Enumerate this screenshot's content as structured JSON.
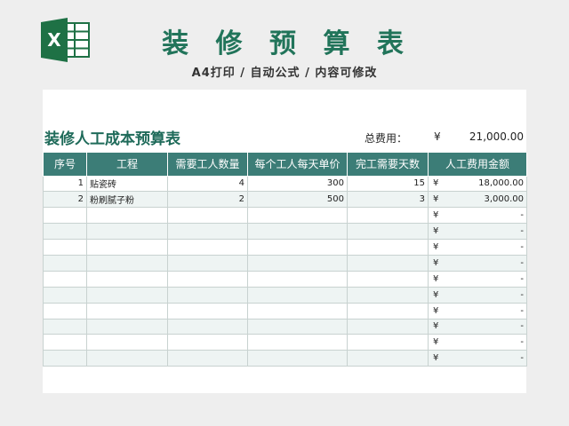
{
  "header": {
    "app_icon": "excel-icon",
    "title": "装 修 预 算 表",
    "subtitle": "A4打印 / 自动公式 / 内容可修改"
  },
  "sheet": {
    "title": "装修人工成本预算表",
    "total_label": "总费用：",
    "currency": "¥",
    "total_value": "21,000.00",
    "columns": [
      "序号",
      "工程",
      "需要工人数量",
      "每个工人每天单价",
      "完工需要天数",
      "人工费用金额"
    ],
    "rows": [
      {
        "no": "1",
        "item": "贴瓷砖",
        "workers": "4",
        "price": "300",
        "days": "15",
        "currency": "¥",
        "amount": "18,000.00"
      },
      {
        "no": "2",
        "item": "粉刷腻子粉",
        "workers": "2",
        "price": "500",
        "days": "3",
        "currency": "¥",
        "amount": "3,000.00"
      },
      {
        "no": "",
        "item": "",
        "workers": "",
        "price": "",
        "days": "",
        "currency": "¥",
        "amount": "-"
      },
      {
        "no": "",
        "item": "",
        "workers": "",
        "price": "",
        "days": "",
        "currency": "¥",
        "amount": "-"
      },
      {
        "no": "",
        "item": "",
        "workers": "",
        "price": "",
        "days": "",
        "currency": "¥",
        "amount": "-"
      },
      {
        "no": "",
        "item": "",
        "workers": "",
        "price": "",
        "days": "",
        "currency": "¥",
        "amount": "-"
      },
      {
        "no": "",
        "item": "",
        "workers": "",
        "price": "",
        "days": "",
        "currency": "¥",
        "amount": "-"
      },
      {
        "no": "",
        "item": "",
        "workers": "",
        "price": "",
        "days": "",
        "currency": "¥",
        "amount": "-"
      },
      {
        "no": "",
        "item": "",
        "workers": "",
        "price": "",
        "days": "",
        "currency": "¥",
        "amount": "-"
      },
      {
        "no": "",
        "item": "",
        "workers": "",
        "price": "",
        "days": "",
        "currency": "¥",
        "amount": "-"
      },
      {
        "no": "",
        "item": "",
        "workers": "",
        "price": "",
        "days": "",
        "currency": "¥",
        "amount": "-"
      },
      {
        "no": "",
        "item": "",
        "workers": "",
        "price": "",
        "days": "",
        "currency": "¥",
        "amount": "-"
      }
    ]
  },
  "colors": {
    "accent": "#21745a",
    "header_bg": "#3c7d77"
  }
}
